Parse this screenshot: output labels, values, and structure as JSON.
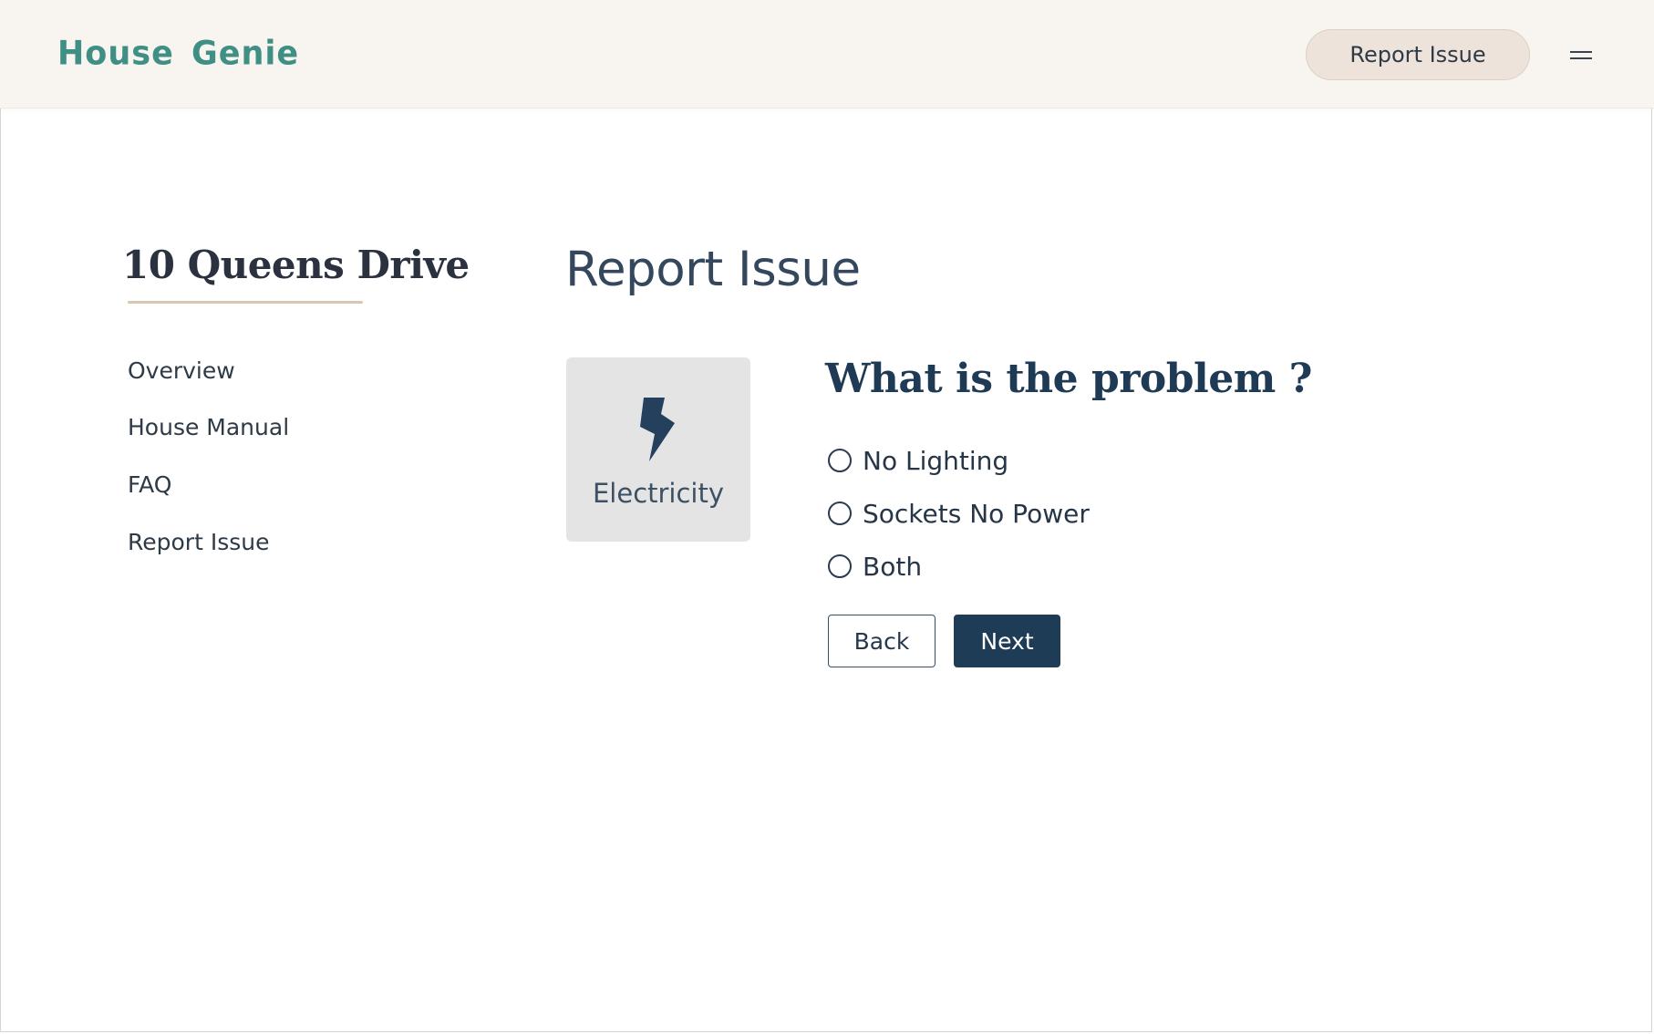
{
  "header": {
    "logo": "House Genie",
    "report_button": "Report Issue",
    "menu_icon": "hamburger-menu-icon"
  },
  "sidebar": {
    "address": "10 Queens Drive",
    "items": [
      {
        "label": "Overview"
      },
      {
        "label": "House Manual"
      },
      {
        "label": "FAQ"
      },
      {
        "label": "Report Issue"
      }
    ]
  },
  "main": {
    "title": "Report Issue",
    "category": {
      "icon": "lightning-bolt-icon",
      "label": "Electricity"
    },
    "question": "What is the problem ?",
    "options": [
      {
        "label": "No Lighting",
        "selected": false
      },
      {
        "label": "Sockets No Power",
        "selected": false
      },
      {
        "label": "Both",
        "selected": false
      }
    ],
    "back_label": "Back",
    "next_label": "Next"
  },
  "colors": {
    "brand": "#3f8f84",
    "header_bg": "#f8f5f0",
    "pill_bg": "#ede3da",
    "accent_underline": "#d9c6b0",
    "primary": "#1f3c57",
    "card_bg": "#e4e4e4"
  }
}
